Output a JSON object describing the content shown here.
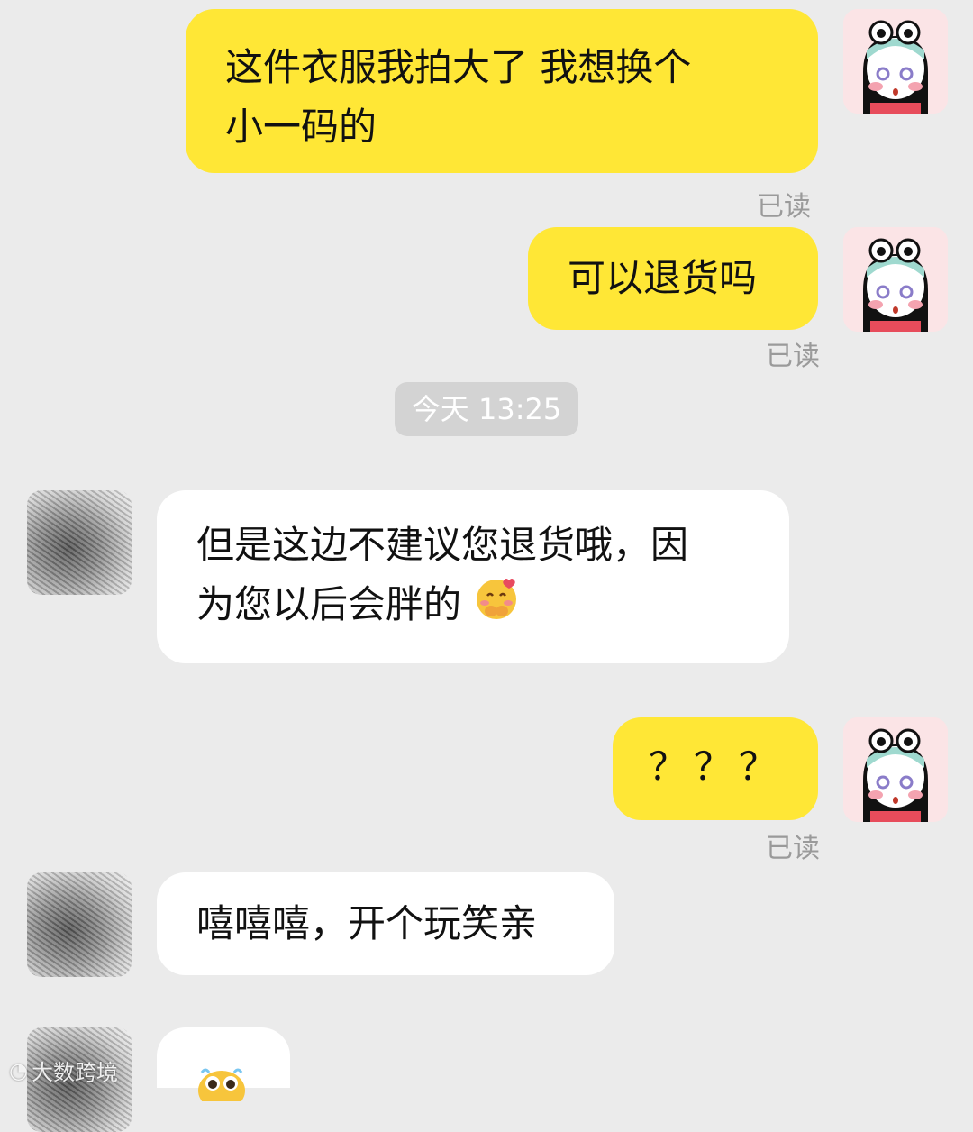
{
  "messages": [
    {
      "text_line1": "这件衣服我拍大了 我想换个",
      "text_line2": "小一码的",
      "status": "已读"
    },
    {
      "text": "可以退货吗",
      "status": "已读"
    },
    {
      "timestamp": "今天 13:25"
    },
    {
      "text_line1": "但是这边不建议您退货哦，因",
      "text_line2": "为您以后会胖的",
      "emoji": "smiling-face-with-hearts-emoji"
    },
    {
      "text": "？？？",
      "status": "已读"
    },
    {
      "text": "嘻嘻嘻，开个玩笑亲"
    },
    {
      "emoji": "cute-crying-emoji"
    }
  ],
  "watermark": {
    "text": "大数跨境"
  },
  "colors": {
    "my_bubble": "#ffe736",
    "shop_bubble": "#ffffff",
    "background": "#ebebeb"
  }
}
